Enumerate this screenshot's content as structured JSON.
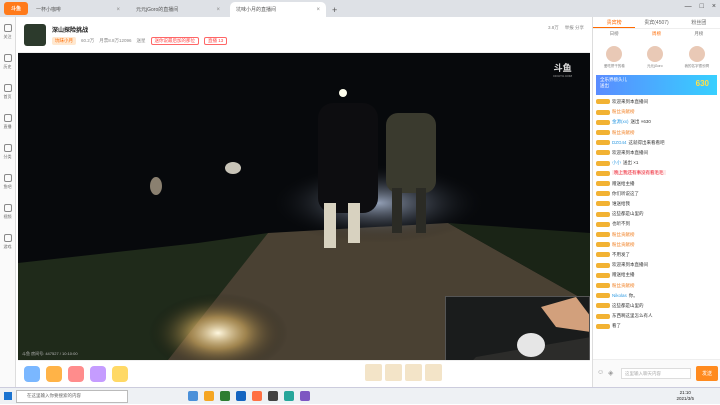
{
  "browser": {
    "logo_text": "斗鱼",
    "tabs": [
      {
        "label": "一杯小咖啡",
        "active": false
      },
      {
        "label": "元元jGoro的直播间",
        "active": false
      },
      {
        "label": "坑味小月的直播间",
        "active": true
      }
    ]
  },
  "left_nav": [
    {
      "label": "关注"
    },
    {
      "label": "历史"
    },
    {
      "label": "首页"
    },
    {
      "label": "直播"
    },
    {
      "label": "分类"
    },
    {
      "label": "鱼吧"
    },
    {
      "label": "视频"
    },
    {
      "label": "游戏"
    }
  ],
  "room": {
    "title": "深山探险挑战",
    "meta": [
      "坑味小月",
      "60.2万",
      "月票8.8万12096",
      "送星"
    ],
    "badge": "送你说最后加的那位",
    "badge2": "直播 13",
    "right_items": [
      "3.8万",
      "举报 分享"
    ]
  },
  "video": {
    "watermark": "斗鱼",
    "watermark_sub": "DOUYU.COM",
    "stats": "斗鱼 房间号: 447527 / 10:10:00"
  },
  "sidebar": {
    "tabs": [
      "贵宾榜",
      "贵宾(4507)",
      "粉丝团"
    ],
    "subtabs": [
      "日榜",
      "周榜",
      "月榜"
    ],
    "rank": [
      {
        "name": "爱吃饼干的卷"
      },
      {
        "name": "元元jGoro"
      },
      {
        "name": "我的名字很长啊"
      }
    ],
    "banner": {
      "line1": "全乐界榜头儿",
      "line2": "送出",
      "num": "630"
    },
    "chat": [
      {
        "user": "",
        "text": "欢迎来到本直播间"
      },
      {
        "user": "",
        "text": "粉丝贡献榜",
        "warn": true
      },
      {
        "user": "金源(xx)",
        "text": "送出 ×630"
      },
      {
        "user": "",
        "text": "粉丝贡献榜",
        "warn": true
      },
      {
        "user": "DZG44",
        "text": "这就得出来看看吧"
      },
      {
        "user": "",
        "text": "欢迎来到本直播间"
      },
      {
        "user": "小小",
        "text": "送出 ×1"
      },
      {
        "user": "",
        "text": "晚上我还有事没有看毛毛",
        "hl": true
      },
      {
        "user": "",
        "text": "赠送给主播"
      },
      {
        "user": "",
        "text": "你们听说这了"
      },
      {
        "user": "",
        "text": "谁送给我"
      },
      {
        "user": "",
        "text": "这些都是山里的"
      },
      {
        "user": "",
        "text": "也听不到"
      },
      {
        "user": "",
        "text": "粉丝贡献榜",
        "warn": true
      },
      {
        "user": "",
        "text": "粉丝贡献榜",
        "warn": true
      },
      {
        "user": "",
        "text": "不用发了"
      },
      {
        "user": "",
        "text": "欢迎来到本直播间"
      },
      {
        "user": "",
        "text": "赠送给主播"
      },
      {
        "user": "",
        "text": "粉丝贡献榜",
        "warn": true
      },
      {
        "user": "Nikolas",
        "text": "你。"
      },
      {
        "user": "",
        "text": "这些都是山里的"
      },
      {
        "user": "",
        "text": "东西啊这里怎么有人"
      },
      {
        "user": "",
        "text": "看了"
      }
    ],
    "input_placeholder": "这里输入聊天内容",
    "send_label": "发送"
  },
  "taskbar": {
    "search": "在这里输入你要搜索的内容",
    "time": "21:10",
    "date": "2021/3/5"
  }
}
